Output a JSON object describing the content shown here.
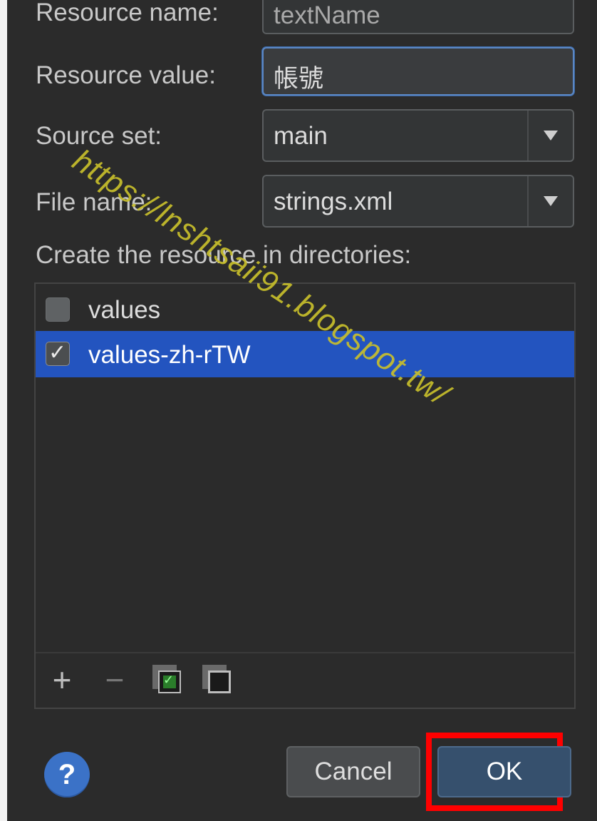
{
  "form": {
    "resource_name_label": "Resource name:",
    "resource_name_value": "textName",
    "resource_value_label": "Resource value:",
    "resource_value_value": "帳號",
    "source_set_label": "Source set:",
    "source_set_value": "main",
    "file_name_label": "File name:",
    "file_name_value": "strings.xml",
    "directories_label": "Create the resource in directories:"
  },
  "directories": [
    {
      "label": "values",
      "checked": false,
      "selected": false
    },
    {
      "label": "values-zh-rTW",
      "checked": true,
      "selected": true
    }
  ],
  "toolbar": {
    "add_icon": "plus-icon",
    "remove_icon": "minus-icon",
    "select_all_icon": "check-all-icon",
    "unselect_all_icon": "uncheck-all-icon"
  },
  "buttons": {
    "help": "?",
    "cancel": "Cancel",
    "ok": "OK"
  },
  "watermark": "https://lnshtsaii91.blogspot.tw/",
  "colors": {
    "selection": "#2354bf",
    "highlight_frame": "#ff0000",
    "ok_button": "#36506d",
    "watermark": "#c8bf2c"
  }
}
